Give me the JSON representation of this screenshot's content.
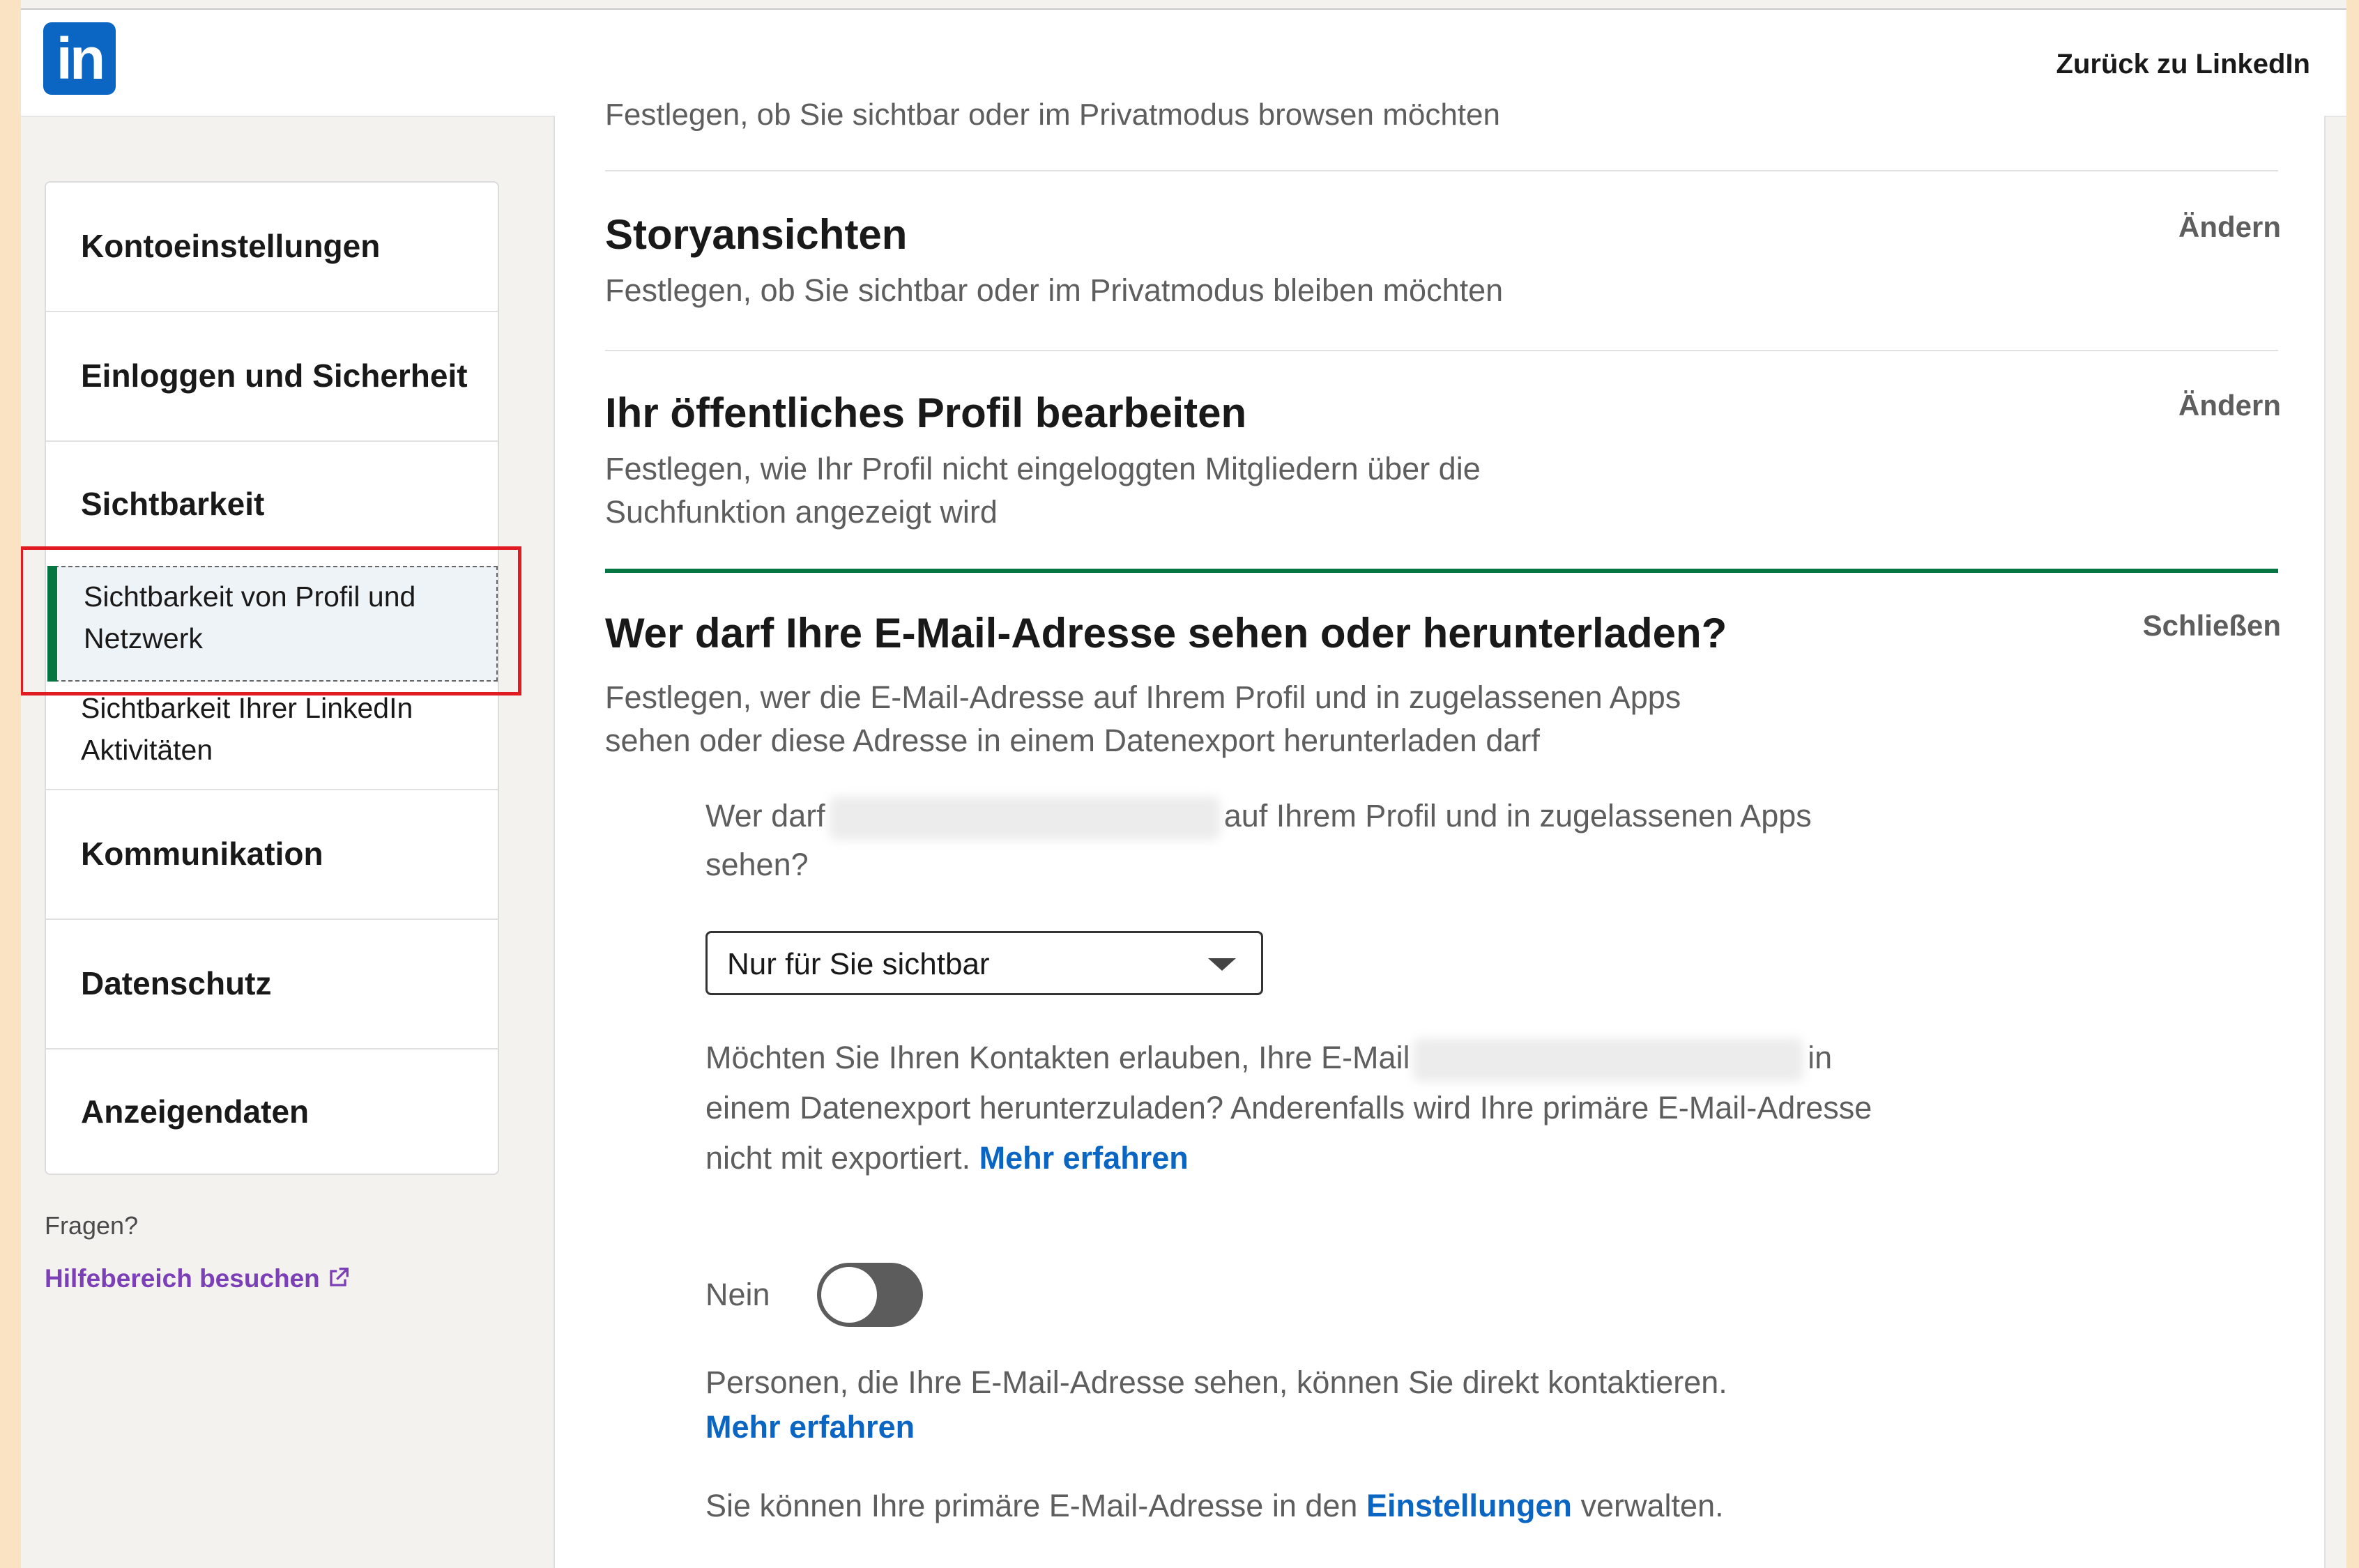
{
  "header": {
    "logo_text": "in",
    "back_link": "Zurück zu LinkedIn"
  },
  "sidebar": {
    "sections": [
      {
        "label": "Kontoeinstellungen"
      },
      {
        "label": "Einloggen und Sicherheit"
      },
      {
        "label": "Sichtbarkeit",
        "subitems": [
          {
            "label": "Sichtbarkeit von Profil und Netzwerk",
            "active": true
          },
          {
            "label": "Sichtbarkeit Ihrer LinkedIn Aktivitäten"
          }
        ]
      },
      {
        "label": "Kommunikation"
      },
      {
        "label": "Datenschutz"
      },
      {
        "label": "Anzeigendaten"
      }
    ],
    "faq_label": "Fragen?",
    "help_link": "Hilfebereich besuchen"
  },
  "main": {
    "cut_off_text": "Festlegen, ob Sie sichtbar oder im Privatmodus browsen möchten",
    "story_views": {
      "title": "Storyansichten",
      "description": "Festlegen, ob Sie sichtbar oder im Privatmodus bleiben möchten",
      "action": "Ändern"
    },
    "public_profile": {
      "title": "Ihr öffentliches Profil bearbeiten",
      "description": "Festlegen, wie Ihr Profil nicht eingeloggten Mitgliedern über die Suchfunktion angezeigt wird",
      "action": "Ändern"
    },
    "email_visibility": {
      "title": "Wer darf Ihre E-Mail-Adresse sehen oder herunterladen?",
      "description": "Festlegen, wer die E-Mail-Adresse auf Ihrem Profil und in zugelassenen Apps sehen oder diese Adresse in einem Datenexport herunterladen darf",
      "action": "Schließen",
      "question_prefix": "Wer darf",
      "question_suffix": "auf Ihrem Profil und in zugelassenen Apps sehen?",
      "select_value": "Nur für Sie sichtbar",
      "export_question_prefix": "Möchten Sie Ihren Kontakten erlauben, Ihre E-Mail",
      "export_question_suffix": "in einem Datenexport herunterzuladen? Anderenfalls wird Ihre primäre E-Mail-Adresse nicht mit exportiert.",
      "learn_more_1": "Mehr erfahren",
      "toggle_label": "Nein",
      "toggle_on": false,
      "contact_note": "Personen, die Ihre E-Mail-Adresse sehen, können Sie direkt kontaktieren.",
      "learn_more_2": "Mehr erfahren",
      "manage_prefix": "Sie können Ihre primäre E-Mail-Adresse in den",
      "manage_link": "Einstellungen",
      "manage_suffix": "verwalten."
    }
  },
  "colors": {
    "brand": "#0a66c2",
    "active_green": "#057642",
    "highlight_red": "#e11b22",
    "help_link_purple": "#7b3fb8"
  }
}
